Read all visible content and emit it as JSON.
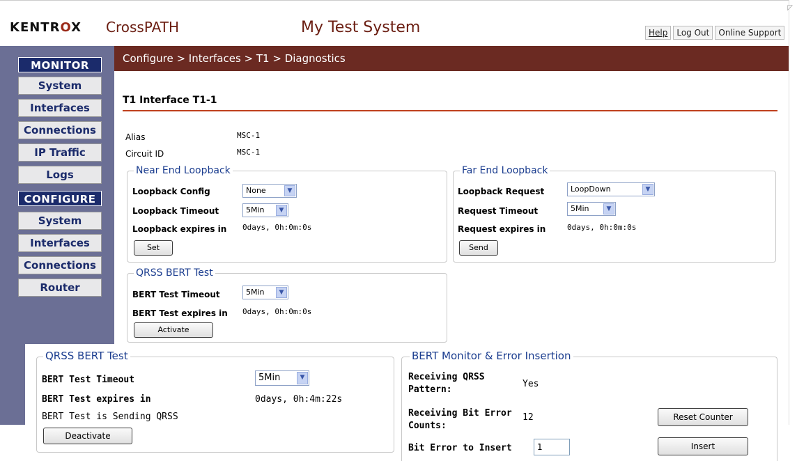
{
  "header": {
    "logo": "KENTROX",
    "product": "CrossPATH",
    "system_name": "My Test System",
    "links": [
      "Help",
      "Log Out",
      "Online Support"
    ]
  },
  "nav": {
    "monitor_title": "MONITOR",
    "monitor_items": [
      "System",
      "Interfaces",
      "Connections",
      "IP Traffic",
      "Logs"
    ],
    "configure_title": "CONFIGURE",
    "configure_items": [
      "System",
      "Interfaces",
      "Connections",
      "Router"
    ]
  },
  "breadcrumb": "Configure >  Interfaces  >  T1  >  Diagnostics",
  "page": {
    "title": "T1 Interface T1-1",
    "alias_label": "Alias",
    "alias_value": "MSC-1",
    "circuit_label": "Circuit ID",
    "circuit_value": "MSC-1"
  },
  "near_end": {
    "legend": "Near End Loopback",
    "config_label": "Loopback Config",
    "config_value": "None",
    "timeout_label": "Loopback Timeout",
    "timeout_value": "5Min",
    "expires_label": "Loopback expires in",
    "expires_value": "0days, 0h:0m:0s",
    "button": "Set"
  },
  "far_end": {
    "legend": "Far End Loopback",
    "request_label": "Loopback Request",
    "request_value": "LoopDown",
    "timeout_label": "Request Timeout",
    "timeout_value": "5Min",
    "expires_label": "Request expires in",
    "expires_value": "0days, 0h:0m:0s",
    "button": "Send"
  },
  "bert": {
    "legend": "QRSS BERT Test",
    "timeout_label": "BERT Test Timeout",
    "timeout_value": "5Min",
    "expires_label": "BERT Test expires in",
    "expires_value": "0days, 0h:0m:0s",
    "button": "Activate"
  },
  "overlay_bert": {
    "legend": "QRSS BERT Test",
    "timeout_label": "BERT Test Timeout",
    "timeout_value": "5Min",
    "expires_label": "BERT Test expires in",
    "expires_value": "0days, 0h:4m:22s",
    "status": "BERT Test is Sending QRSS",
    "button": "Deactivate"
  },
  "overlay_monitor": {
    "legend": "BERT Monitor & Error Insertion",
    "pattern_label_1": "Receiving QRSS",
    "pattern_label_2": "Pattern:",
    "pattern_value": "Yes",
    "errors_label_1": "Receiving Bit Error",
    "errors_label_2": "Counts:",
    "errors_value": "12",
    "reset_button": "Reset Counter",
    "insert_label": "Bit Error to Insert",
    "insert_value": "1",
    "insert_button": "Insert"
  }
}
